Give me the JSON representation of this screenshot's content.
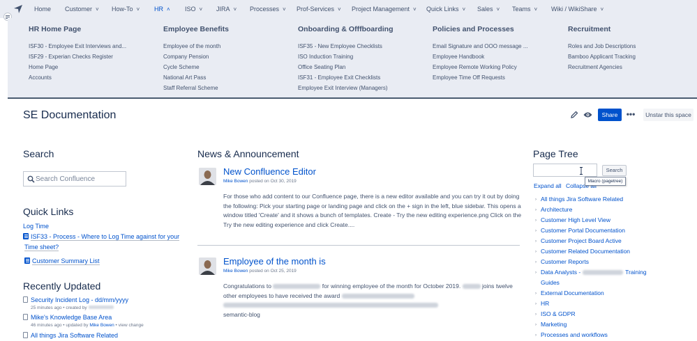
{
  "nav": {
    "items": [
      {
        "label": "Home",
        "has_chevron": false
      },
      {
        "label": "Customer",
        "has_chevron": true
      },
      {
        "label": "How-To",
        "has_chevron": true
      },
      {
        "label": "HR",
        "has_chevron": true,
        "expanded": true
      },
      {
        "label": "ISO",
        "has_chevron": true
      },
      {
        "label": "JIRA",
        "has_chevron": true
      },
      {
        "label": "Processes",
        "has_chevron": true
      },
      {
        "label": "Prof-Services",
        "has_chevron": true
      },
      {
        "label": "Project Management",
        "has_chevron": true
      },
      {
        "label": "Quick Links",
        "has_chevron": true
      },
      {
        "label": "Sales",
        "has_chevron": true
      },
      {
        "label": "Teams",
        "has_chevron": true
      },
      {
        "label": "Wiki / WikiShare",
        "has_chevron": true
      }
    ]
  },
  "megamenu": {
    "columns": [
      {
        "title": "HR Home Page",
        "links": [
          "ISF30 - Employee Exit Interviews and...",
          "ISF29 - Experian Checks Register",
          "Home Page",
          "Accounts"
        ]
      },
      {
        "title": "Employee Benefits",
        "links": [
          "Employee of the month",
          "Company Pension",
          "Cycle Scheme",
          "National Art Pass",
          "Staff Referral Scheme"
        ]
      },
      {
        "title": "Onboarding & Offfboarding",
        "links": [
          "ISF35 - New Employee Checklists",
          "ISO Induction Training",
          "Office Seating Plan",
          "ISF31 - Employee Exit Checklists",
          "Employee Exit Interview (Managers)"
        ]
      },
      {
        "title": "Policies and Processes",
        "links": [
          "Email Signature and OOO message ...",
          "Employee Handbook",
          "Employee Remote Working Policy",
          "Employee Time Off Requests"
        ]
      },
      {
        "title": "Recruitment",
        "links": [
          "Roles and Job Descriptions",
          "Bamboo Applicant Tracking",
          "Recruitment Agencies"
        ]
      }
    ]
  },
  "page": {
    "title": "SE Documentation",
    "share_label": "Share",
    "more_label": "•••",
    "unstar_label": "Unstar this space"
  },
  "search": {
    "heading": "Search",
    "placeholder": "Search Confluence"
  },
  "quick_links": {
    "heading": "Quick Links",
    "log_time": "Log Time",
    "isf33_line1": "ISF33 - Process - Where to Log Time against for your",
    "isf33_line2": "Time sheet?",
    "customer_summary": "Customer Summary List"
  },
  "recently_updated": {
    "heading": "Recently Updated",
    "items": [
      {
        "title": "Security Incident Log - dd/mm/yyyy",
        "meta_prefix": "25 minutes ago • created by"
      },
      {
        "title": "Mike's Knowledge Base Area",
        "meta_prefix": "46 minutes ago • updated by",
        "author": "Mike Bowen",
        "meta_suffix": "• view change"
      },
      {
        "title": "All things Jira Software Related"
      }
    ]
  },
  "news": {
    "heading": "News & Announcement",
    "posts": [
      {
        "title": "New Confluence Editor",
        "author": "Mike Bowen",
        "date": "posted on Oct 30, 2019",
        "body": "For those who add content to our Confluence page, there is a new editor available and you can try it out by doing the following: Pick your starting page or landing page and click on the + sign in the left, blue sidebar. This opens a window titled 'Create' and it shows a bunch of templates. Create - Try the new editing experience.png Click on the Try the new editing experience and click Create...."
      },
      {
        "title": "Employee of the month is",
        "author": "Mike Bowen",
        "date": "posted on Oct 25, 2019",
        "body_p1": "Congratulations to",
        "body_p2": "for winning employee of the month for October 2019.",
        "body_p3": "joins",
        "body_p4": "twelve other employees to have received the award",
        "body_tag": "semantic-blog"
      }
    ]
  },
  "page_tree": {
    "heading": "Page Tree",
    "search_button": "Search",
    "tooltip": "Macro (pagetree)",
    "expand_all": "Expand all",
    "collapse_all": "Collapse all",
    "items": [
      "All things Jira Software Related",
      "Architecture",
      "Customer High Level View",
      "Customer Portal Documentation",
      "Customer Project Board Active",
      "Customer Related Documentation",
      "Customer Reports",
      "Data Analysts -",
      "Training",
      "Guides",
      "External Documentation",
      "HR",
      "ISO & GDPR",
      "Marketing",
      "Processes and workflows"
    ]
  },
  "colors": {
    "accent": "#0052cc",
    "nav_bg": "#e9ecf3",
    "text": "#172b4d"
  }
}
